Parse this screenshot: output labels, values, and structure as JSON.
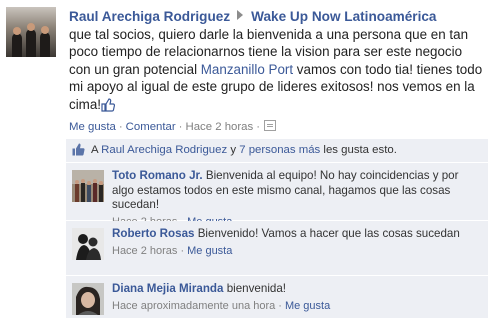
{
  "post": {
    "author": "Raul Arechiga Rodriguez",
    "group": "Wake Up Now Latinoamérica",
    "text_before": "que tal socios, quiero darle la bienvenida a una persona que en tan poco tiempo de relacionarnos tiene la vision para ser este negocio con un gran potencial ",
    "link": "Manzanillo Port",
    "text_after": " vamos con todo tia! tienes todo mi apoyo al igual de este grupo de lideres exitosos! nos vemos en la cima!",
    "like_label": "Me gusta",
    "comment_label": "Comentar",
    "time": "Hace 2 horas",
    "separator": "·"
  },
  "likes": {
    "prefix": "A",
    "name": "Raul Arechiga Rodriguez",
    "conj": "y",
    "others": "7 personas más",
    "suffix": "les gusta esto."
  },
  "comments": [
    {
      "author": "Toto Romano Jr.",
      "text": "Bienvenida al equipo! No hay coincidencias y por algo estamos todos en este mismo canal, hagamos que las cosas sucedan!",
      "time": "Hace 2 horas",
      "like_label": "Me gusta"
    },
    {
      "author": "Roberto Rosas",
      "text": "Bienvenido! Vamos a hacer que las cosas sucedan",
      "time": "Hace 2 horas",
      "like_label": "Me gusta"
    },
    {
      "author": "Diana Mejia Miranda",
      "text": "bienvenida!",
      "time": "Hace aproximadamente una hora",
      "like_label": "Me gusta"
    }
  ],
  "icons": {
    "like": "thumbs-up-icon",
    "arrow": "arrow-right-icon",
    "comment_box": "comment-box-icon"
  },
  "colors": {
    "link": "#3b5998",
    "feedback_bg": "#edeff4",
    "meta": "#808080"
  }
}
